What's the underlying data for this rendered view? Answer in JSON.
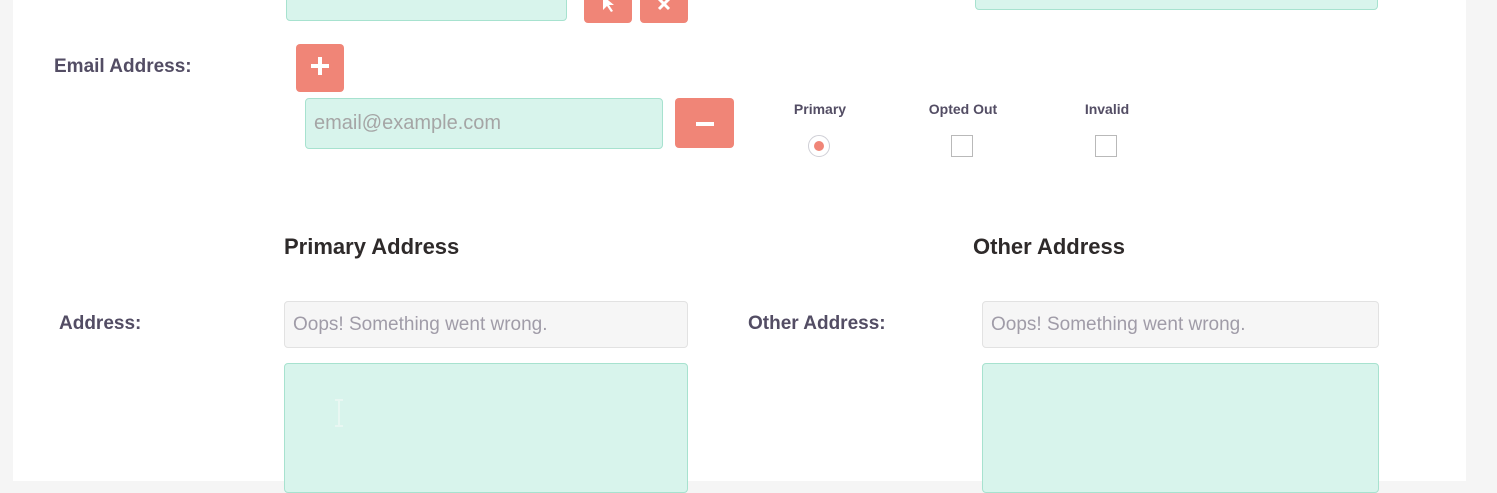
{
  "email": {
    "label": "Email Address:",
    "placeholder": "email@example.com",
    "flag_headers": [
      "Primary",
      "Opted Out",
      "Invalid"
    ],
    "flags": {
      "primary": true,
      "opted_out": false,
      "invalid": false
    }
  },
  "primary_address": {
    "title": "Primary Address",
    "label": "Address:",
    "lookup_text": "Oops! Something went wrong."
  },
  "other_address": {
    "title": "Other Address",
    "label": "Other Address:",
    "lookup_text": "Oops! Something went wrong."
  },
  "colors": {
    "accent": "#f08577",
    "field_bg": "#d8f4ec",
    "field_border": "#a7e2cf",
    "label": "#534d64"
  },
  "icons": [
    "select-arrow-icon",
    "clear-icon",
    "plus-icon",
    "minus-icon",
    "text-cursor-icon"
  ]
}
